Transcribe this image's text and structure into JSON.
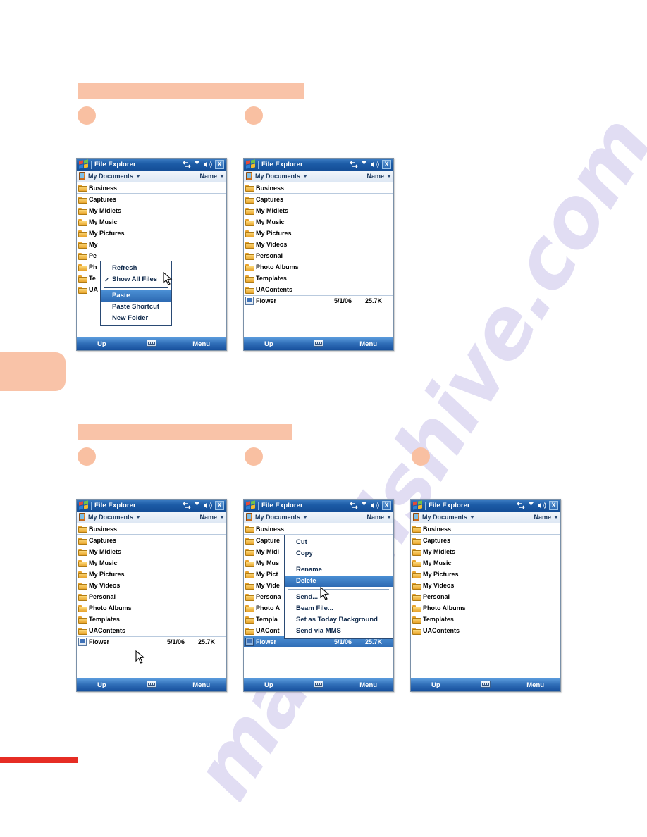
{
  "page": {
    "watermark_text": "manualshive.com",
    "accent_peach": "#f9c3a8",
    "accent_red": "#e62d24",
    "divider_color": "#e8a882"
  },
  "app": {
    "title": "File Explorer",
    "path_label": "My Documents",
    "sort_label": "Name",
    "softkey_left": "Up",
    "softkey_right": "Menu",
    "icons": {
      "windows_logo": "windows-logo-icon",
      "connectivity": "connectivity-icon",
      "signal": "signal-icon",
      "volume": "volume-icon",
      "close": "X",
      "keyboard": "keyboard-icon",
      "device": "device-icon"
    }
  },
  "folders": {
    "full": [
      "Business",
      "Captures",
      "My Midlets",
      "My Music",
      "My Pictures",
      "My Videos",
      "Personal",
      "Photo Albums",
      "Templates",
      "UAContents"
    ],
    "truncated_menu1": [
      "Business",
      "Captures",
      "My Midlets",
      "My Music",
      "My Pictures",
      "My",
      "Pe",
      "Ph",
      "Te",
      "UA"
    ],
    "truncated_menu2": [
      "Business",
      "Capture",
      "My Midl",
      "My Mus",
      "My Pict",
      "My Vide",
      "Persona",
      "Photo A",
      "Templa",
      "UACont"
    ]
  },
  "file": {
    "name": "Flower",
    "date": "5/1/06",
    "size": "25.7K"
  },
  "menu_paste": {
    "items": [
      {
        "label": "Refresh",
        "checked": false,
        "highlighted": false,
        "sep_after": false
      },
      {
        "label": "Show All Files",
        "checked": true,
        "highlighted": false,
        "sep_after": true
      },
      {
        "label": "Paste",
        "checked": false,
        "highlighted": true,
        "sep_after": false
      },
      {
        "label": "Paste Shortcut",
        "checked": false,
        "highlighted": false,
        "sep_after": false
      },
      {
        "label": "New Folder",
        "checked": false,
        "highlighted": false,
        "sep_after": false
      }
    ]
  },
  "menu_file": {
    "items": [
      {
        "label": "Cut",
        "checked": false,
        "highlighted": false,
        "sep_after": false
      },
      {
        "label": "Copy",
        "checked": false,
        "highlighted": false,
        "sep_after": true
      },
      {
        "label": "Rename",
        "checked": false,
        "highlighted": false,
        "sep_after": false
      },
      {
        "label": "Delete",
        "checked": false,
        "highlighted": true,
        "sep_after": true
      },
      {
        "label": "Send...",
        "checked": false,
        "highlighted": false,
        "sep_after": false
      },
      {
        "label": "Beam File...",
        "checked": false,
        "highlighted": false,
        "sep_after": false
      },
      {
        "label": "Set as Today Background",
        "checked": false,
        "highlighted": false,
        "sep_after": false
      },
      {
        "label": "Send via MMS",
        "checked": false,
        "highlighted": false,
        "sep_after": false
      }
    ]
  },
  "screenshots": [
    {
      "name": "screenshot-paste-menu",
      "row": "top",
      "col": 1
    },
    {
      "name": "screenshot-pasted-result",
      "row": "top",
      "col": 2
    },
    {
      "name": "screenshot-file-selected",
      "row": "bottom",
      "col": 1
    },
    {
      "name": "screenshot-file-context-menu",
      "row": "bottom",
      "col": 2
    },
    {
      "name": "screenshot-file-deleted",
      "row": "bottom",
      "col": 3
    }
  ]
}
